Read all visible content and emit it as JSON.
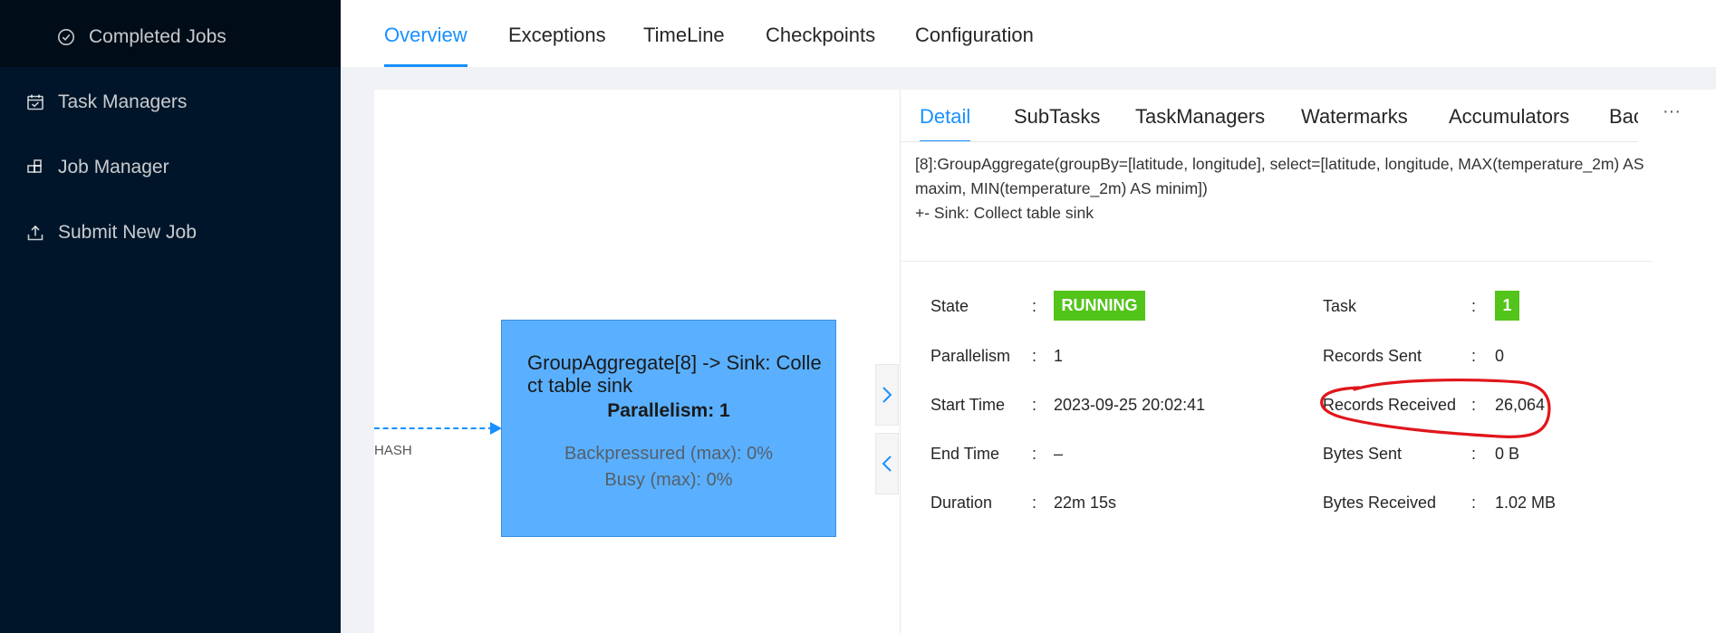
{
  "sidebar": {
    "items": [
      {
        "label": "Completed Jobs",
        "icon": "check-circle-icon"
      },
      {
        "label": "Task Managers",
        "icon": "calendar-check-icon"
      },
      {
        "label": "Job Manager",
        "icon": "cluster-icon"
      },
      {
        "label": "Submit New Job",
        "icon": "upload-icon"
      }
    ]
  },
  "top_tabs": [
    "Overview",
    "Exceptions",
    "TimeLine",
    "Checkpoints",
    "Configuration"
  ],
  "graph": {
    "edge_label": "HASH",
    "node": {
      "name": "GroupAggregate[8] -> Sink: Collect table sink",
      "parallelism": "Parallelism: 1",
      "backpressured": "Backpressured (max): 0%",
      "busy": "Busy (max): 0%"
    }
  },
  "detail": {
    "tabs": [
      "Detail",
      "SubTasks",
      "TaskManagers",
      "Watermarks",
      "Accumulators",
      "Bac"
    ],
    "more": "···",
    "description_line1": "[8]:GroupAggregate(groupBy=[latitude, longitude], select=[latitude, longitude, MAX(temperature_2m) AS maxim, MIN(temperature_2m) AS minim])",
    "description_line2": "+- Sink: Collect table sink",
    "left_fields": [
      {
        "label": "State",
        "value": "RUNNING"
      },
      {
        "label": "Parallelism",
        "value": "1"
      },
      {
        "label": "Start Time",
        "value": "2023-09-25 20:02:41"
      },
      {
        "label": "End Time",
        "value": "–"
      },
      {
        "label": "Duration",
        "value": "22m 15s"
      }
    ],
    "right_fields": [
      {
        "label": "Task",
        "value": "1"
      },
      {
        "label": "Records Sent",
        "value": "0"
      },
      {
        "label": "Records Received",
        "value": "26,064"
      },
      {
        "label": "Bytes Sent",
        "value": "0 B"
      },
      {
        "label": "Bytes Received",
        "value": "1.02 MB"
      }
    ],
    "colon": ":"
  },
  "colors": {
    "accent": "#1890ff",
    "running": "#52c41a",
    "sidebar": "#001529",
    "node": "#5ab0ff",
    "annotation": "#e0161b"
  }
}
